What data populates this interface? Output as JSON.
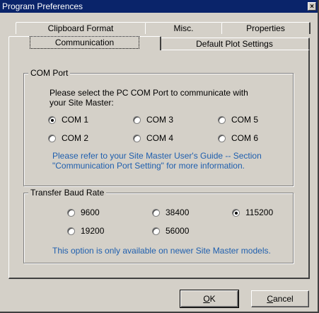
{
  "window": {
    "title": "Program Preferences",
    "close_glyph": "×"
  },
  "tabs": {
    "back_row": [
      "Clipboard Format",
      "Misc.",
      "Properties"
    ],
    "front_row": [
      "Communication",
      "Default Plot Settings"
    ],
    "selected": "Communication"
  },
  "com_port": {
    "title": "COM Port",
    "instruction_line1": "Please select the PC COM Port to communicate with",
    "instruction_line2": "your Site Master:",
    "options": [
      "COM 1",
      "COM 3",
      "COM 5",
      "COM 2",
      "COM 4",
      "COM 6"
    ],
    "selected": "COM 1",
    "note_line1": "Please refer to your Site Master User's Guide  -- Section",
    "note_line2": "\"Communication Port Setting\" for more information."
  },
  "baud_rate": {
    "title": "Transfer Baud Rate",
    "options": [
      "9600",
      "38400",
      "115200",
      "19200",
      "56000"
    ],
    "selected": "115200",
    "note": "This option is only available on newer Site Master models."
  },
  "buttons": {
    "ok_mnemonic": "O",
    "ok_rest": "K",
    "cancel_mnemonic": "C",
    "cancel_rest": "ancel"
  },
  "colors": {
    "title_bar": "#0a246a",
    "face": "#d4d0c8",
    "note_text": "#1f5fae"
  }
}
